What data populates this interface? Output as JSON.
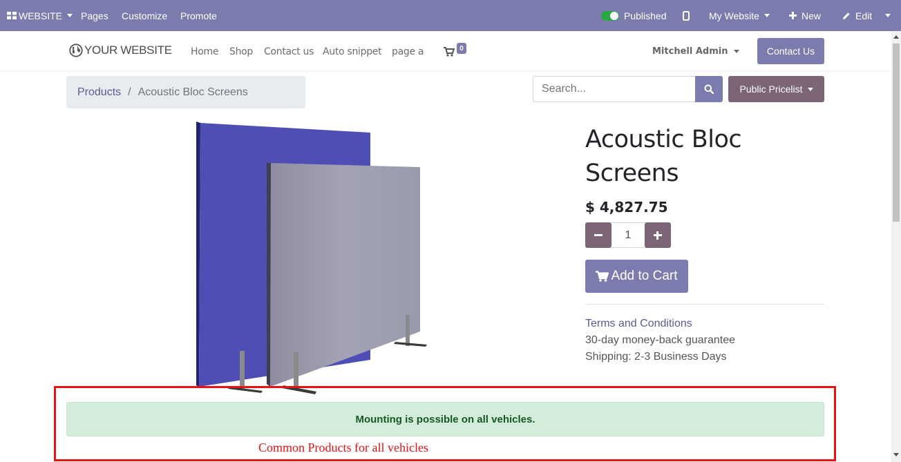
{
  "admin_bar": {
    "app_menu": "WEBSITE",
    "pages": "Pages",
    "customize": "Customize",
    "promote": "Promote",
    "published": "Published",
    "site_selector": "My Website",
    "new": "New",
    "edit": "Edit",
    "background_color": "#7c7bad"
  },
  "header": {
    "logo_text": "YOUR WEBSITE",
    "nav": [
      "Home",
      "Shop",
      "Contact us",
      "Auto snippet",
      "page a"
    ],
    "cart_count": "0",
    "user_name": "Mitchell Admin",
    "contact_button": "Contact Us"
  },
  "breadcrumb": {
    "parent": "Products",
    "separator": "/",
    "current": "Acoustic Bloc Screens"
  },
  "search": {
    "placeholder": "Search...",
    "pricelist": "Public Pricelist"
  },
  "product": {
    "title_line1": "Acoustic Bloc",
    "title_line2": "Screens",
    "price": "$ 4,827.75",
    "quantity": "1",
    "add_to_cart": "Add to Cart",
    "terms": "Terms and Conditions",
    "guarantee": "30-day money-back guarantee",
    "shipping": "Shipping: 2-3 Business Days"
  },
  "alert": {
    "message": "Mounting is possible on all vehicles."
  },
  "annotation": {
    "text": "Common Products for all vehicles",
    "color": "#e31313"
  },
  "colors": {
    "primary": "#7c7bad",
    "secondary": "#7c6576",
    "alert_bg": "#d4edda",
    "alert_text": "#155724"
  }
}
